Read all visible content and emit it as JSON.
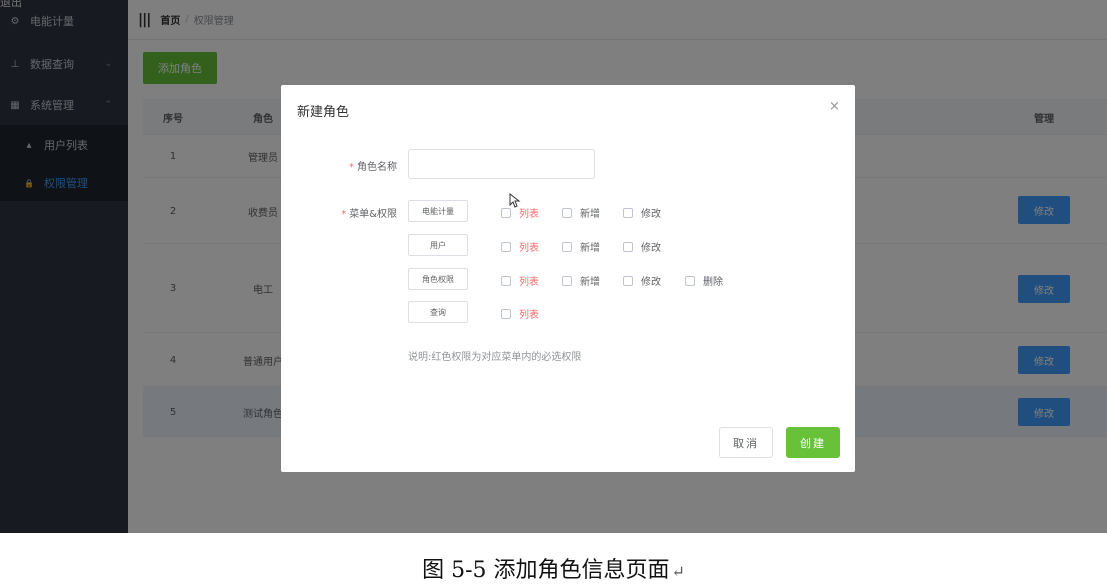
{
  "sidebar": {
    "top_fragment": "退出",
    "items": [
      {
        "icon": "gauge-icon",
        "glyph": "⚙",
        "label": "电能计量"
      },
      {
        "icon": "sitemap-icon",
        "glyph": "⊥",
        "label": "数据查询",
        "arrow": "⌄"
      },
      {
        "icon": "grid-icon",
        "glyph": "▦",
        "label": "系统管理",
        "arrow": "⌃"
      }
    ],
    "sub_items": [
      {
        "icon": "user-icon",
        "glyph": "▴",
        "label": "用户列表"
      },
      {
        "icon": "lock-icon",
        "glyph": "🔒",
        "label": "权限管理",
        "active": true
      }
    ]
  },
  "topbar": {
    "menu_icon": "|||",
    "breadcrumb": {
      "home": "首页",
      "sep": "/",
      "current": "权限管理"
    }
  },
  "toolbar": {
    "add_label": "添加角色"
  },
  "table": {
    "headers": {
      "index": "序号",
      "role": "角色",
      "manage": "管理"
    },
    "rows": [
      {
        "index": "1",
        "role": "管理员",
        "action": ""
      },
      {
        "index": "2",
        "role": "收费员",
        "action": "修改"
      },
      {
        "index": "3",
        "role": "电工",
        "action": "修改"
      },
      {
        "index": "4",
        "role": "普通用户",
        "action": "修改"
      },
      {
        "index": "5",
        "role": "测试角色",
        "action": "修改"
      }
    ]
  },
  "dialog": {
    "title": "新建角色",
    "close": "×",
    "name_label": "角色名称",
    "name_value": "",
    "menu_label": "菜单&权限",
    "required_mark": "*",
    "permissions": [
      {
        "menu": "电能计量",
        "options": [
          {
            "label": "列表",
            "required": true
          },
          {
            "label": "新增"
          },
          {
            "label": "修改"
          }
        ]
      },
      {
        "menu": "用户",
        "options": [
          {
            "label": "列表",
            "required": true
          },
          {
            "label": "新增"
          },
          {
            "label": "修改"
          }
        ]
      },
      {
        "menu": "角色权限",
        "options": [
          {
            "label": "列表",
            "required": true
          },
          {
            "label": "新增"
          },
          {
            "label": "修改"
          },
          {
            "label": "删除"
          }
        ]
      },
      {
        "menu": "查询",
        "options": [
          {
            "label": "列表",
            "required": true
          }
        ]
      }
    ],
    "note": "说明:红色权限为对应菜单内的必选权限",
    "cancel_label": "取消",
    "create_label": "创建"
  },
  "caption": {
    "text": "图 5-5 添加角色信息页面",
    "mark": "↵"
  },
  "colors": {
    "sidebar": "#2f3742",
    "submenu": "#1f2630",
    "primary": "#409eff",
    "success": "#67c23a",
    "danger": "#f56c6c"
  }
}
